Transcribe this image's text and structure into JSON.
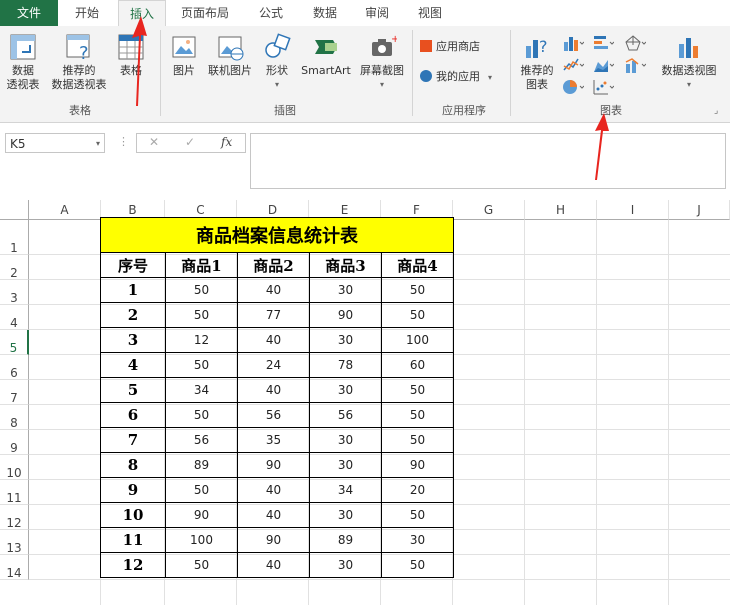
{
  "ribbon_tabs": [
    "文件",
    "开始",
    "插入",
    "页面布局",
    "公式",
    "数据",
    "审阅",
    "视图"
  ],
  "ribbon": {
    "tables": {
      "pivot": "数据\n透视表",
      "recommended_pivot": "推荐的\n数据透视表",
      "table": "表格",
      "label": "表格"
    },
    "illustrations": {
      "picture": "图片",
      "online_picture": "联机图片",
      "shapes": "形状",
      "smartart": "SmartArt",
      "screenshot": "屏幕截图",
      "label": "插图"
    },
    "apps": {
      "store": "应用商店",
      "my_apps": "我的应用",
      "label": "应用程序"
    },
    "charts": {
      "recommended": "推荐的\n图表",
      "pivot_chart": "数据透视图",
      "label": "图表"
    }
  },
  "formula_bar": {
    "name_box": "K5",
    "cancel": "✕",
    "enter": "✓",
    "fx": "fx",
    "value": ""
  },
  "columns": [
    "A",
    "B",
    "C",
    "D",
    "E",
    "F",
    "G",
    "H",
    "I",
    "J"
  ],
  "rows": [
    "1",
    "2",
    "3",
    "4",
    "5",
    "6",
    "7",
    "8",
    "9",
    "10",
    "11",
    "12",
    "13",
    "14"
  ],
  "selected_row": "5",
  "sheet_table": {
    "title": "商品档案信息统计表",
    "headers": [
      "序号",
      "商品1",
      "商品2",
      "商品3",
      "商品4"
    ],
    "rows": [
      [
        "1",
        "50",
        "40",
        "30",
        "50"
      ],
      [
        "2",
        "50",
        "77",
        "90",
        "50"
      ],
      [
        "3",
        "12",
        "40",
        "30",
        "100"
      ],
      [
        "4",
        "50",
        "24",
        "78",
        "60"
      ],
      [
        "5",
        "34",
        "40",
        "30",
        "50"
      ],
      [
        "6",
        "50",
        "56",
        "56",
        "50"
      ],
      [
        "7",
        "56",
        "35",
        "30",
        "50"
      ],
      [
        "8",
        "89",
        "90",
        "30",
        "90"
      ],
      [
        "9",
        "50",
        "40",
        "34",
        "20"
      ],
      [
        "10",
        "90",
        "40",
        "30",
        "50"
      ],
      [
        "11",
        "100",
        "90",
        "89",
        "30"
      ],
      [
        "12",
        "50",
        "40",
        "30",
        "50"
      ]
    ]
  },
  "colors": {
    "excel_green": "#217346",
    "title_fill": "#ffff00",
    "annotation_arrow": "#e8251f"
  }
}
